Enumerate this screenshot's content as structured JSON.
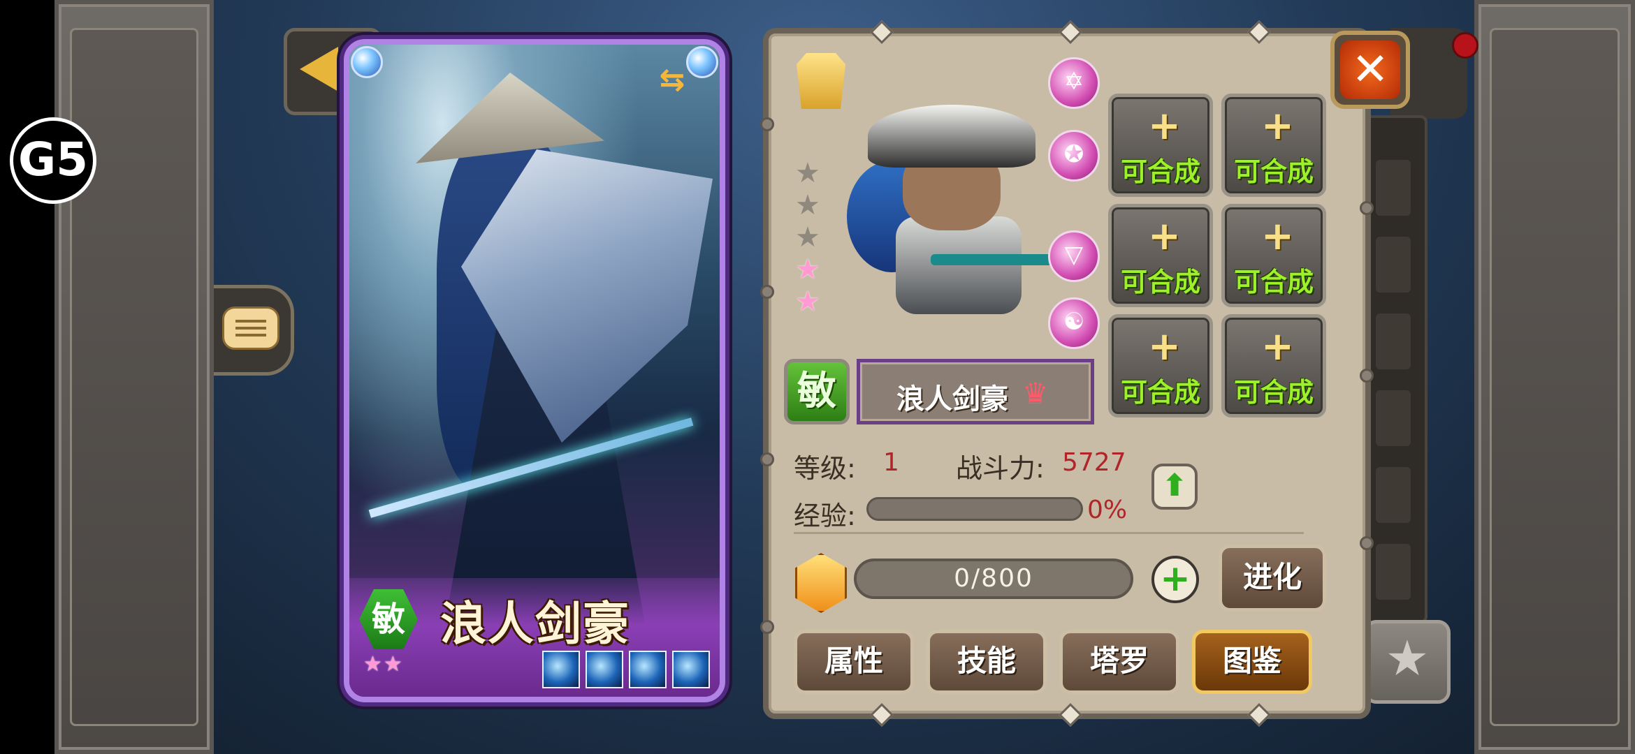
{
  "logo": {
    "text": "G5"
  },
  "hero_card": {
    "type_label": "敏",
    "name": "浪人剑豪",
    "stars": "★★",
    "skill_icons": [
      "ice-slash-skill-icon",
      "wave-skill-icon",
      "ronin-skill-icon",
      "storm-skill-icon"
    ]
  },
  "hero_panel": {
    "type_label": "敏",
    "name": "浪人剑豪",
    "rank_stars": {
      "filled": 2,
      "total": 5
    },
    "equipment": [
      {
        "plus": "+",
        "label": "可合成"
      },
      {
        "plus": "+",
        "label": "可合成"
      },
      {
        "plus": "+",
        "label": "可合成"
      },
      {
        "plus": "+",
        "label": "可合成"
      },
      {
        "plus": "+",
        "label": "可合成"
      },
      {
        "plus": "+",
        "label": "可合成"
      }
    ],
    "stats": {
      "level_label": "等级:",
      "level_value": "1",
      "power_label": "战斗力:",
      "power_value": "5727",
      "exp_label": "经验:",
      "exp_value": "0%",
      "exp_fraction": 0.0
    },
    "shards": {
      "value": "0/800",
      "current": 0,
      "max": 800
    },
    "evolve_label": "进化",
    "tabs": [
      {
        "label": "属性",
        "active": false
      },
      {
        "label": "技能",
        "active": false
      },
      {
        "label": "塔罗",
        "active": false
      },
      {
        "label": "图鉴",
        "active": true
      }
    ]
  },
  "colors": {
    "accent_gold": "#f2c860",
    "panel_bg": "#c9bca6",
    "card_border": "#b283e6",
    "stat_value_red": "#b0252a",
    "equip_text_green": "#9ef02a"
  }
}
